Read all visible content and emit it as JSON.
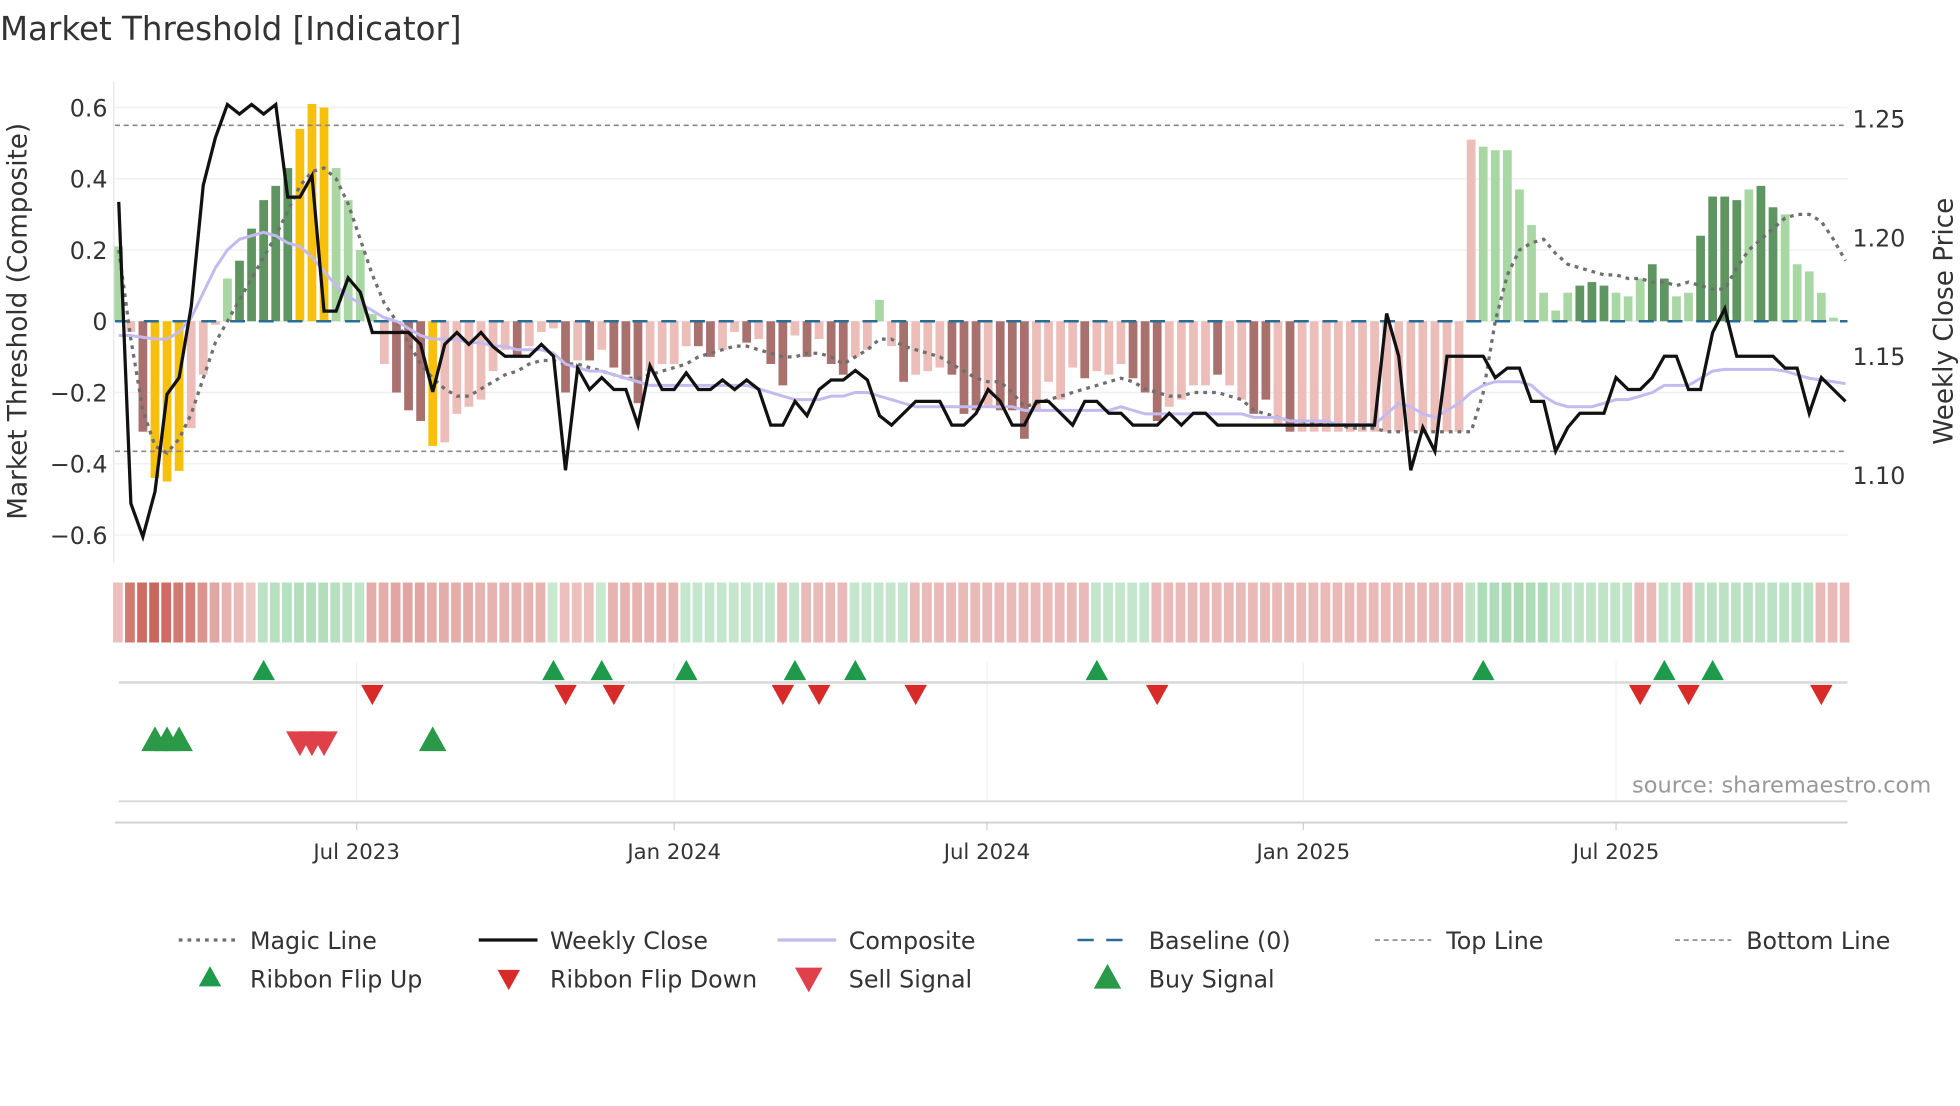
{
  "chart_data": {
    "type": "bar",
    "title": "Market Threshold [Indicator]",
    "ylabel": "Market Threshold (Composite)",
    "ylabel_right": "Weekly Close Price",
    "ylim": [
      -0.677,
      0.674
    ],
    "ylim_right": [
      1.0537,
      1.2605
    ],
    "y_ticks": [
      {
        "v": 0.6,
        "label": "0.6"
      },
      {
        "v": 0.4,
        "label": "0.4"
      },
      {
        "v": 0.2,
        "label": "0.2"
      },
      {
        "v": 0,
        "label": "0"
      },
      {
        "v": -0.2,
        "label": "−0.2"
      },
      {
        "v": -0.4,
        "label": "−0.4"
      },
      {
        "v": -0.6,
        "label": "−0.6"
      }
    ],
    "y_ticks_right": [
      {
        "v": 1.25,
        "label": "1.25"
      },
      {
        "v": 1.2,
        "label": "1.20"
      },
      {
        "v": 1.15,
        "label": "1.15"
      },
      {
        "v": 1.1,
        "label": "1.10"
      }
    ],
    "x_ticks": [
      {
        "week": 19.7,
        "label": "Jul 2023"
      },
      {
        "week": 46.0,
        "label": "Jan 2024"
      },
      {
        "week": 71.9,
        "label": "Jul 2024"
      },
      {
        "week": 98.1,
        "label": "Jan 2025"
      },
      {
        "week": 124.0,
        "label": "Jul 2025"
      }
    ],
    "top_line": 0.55,
    "bottom_line": -0.365,
    "grid": true,
    "source": "source: sharemaestro.com",
    "colors": {
      "L": "#a9d7a3",
      "G": "#5f9560",
      "P": "#ecbdb9",
      "R": "#a9716e",
      "Y": "#f7c00b",
      "close": "#111111",
      "composite": "#c5baef",
      "magic": "#6f6f6f",
      "baseline": "#2a6e96",
      "refline": "#888888"
    },
    "composite_bars": [
      0.21,
      -0.03,
      -0.31,
      -0.44,
      -0.45,
      -0.42,
      -0.3,
      -0.15,
      -0.01,
      0.12,
      0.17,
      0.26,
      0.34,
      0.38,
      0.43,
      0.54,
      0.61,
      0.6,
      0.43,
      0.34,
      0.2,
      0.02,
      -0.12,
      -0.2,
      -0.25,
      -0.28,
      -0.35,
      -0.34,
      -0.26,
      -0.24,
      -0.22,
      -0.14,
      -0.08,
      -0.1,
      -0.07,
      -0.03,
      -0.02,
      -0.2,
      -0.11,
      -0.11,
      -0.08,
      -0.13,
      -0.15,
      -0.23,
      -0.14,
      -0.12,
      -0.12,
      -0.07,
      -0.07,
      -0.1,
      -0.08,
      -0.03,
      -0.06,
      -0.05,
      -0.12,
      -0.18,
      -0.04,
      -0.1,
      -0.05,
      -0.12,
      -0.15,
      -0.1,
      -0.08,
      0.06,
      -0.07,
      -0.17,
      -0.15,
      -0.14,
      -0.13,
      -0.15,
      -0.26,
      -0.25,
      -0.24,
      -0.25,
      -0.25,
      -0.33,
      -0.25,
      -0.17,
      -0.22,
      -0.13,
      -0.16,
      -0.14,
      -0.15,
      -0.12,
      -0.16,
      -0.2,
      -0.28,
      -0.24,
      -0.22,
      -0.18,
      -0.18,
      -0.15,
      -0.18,
      -0.22,
      -0.26,
      -0.22,
      -0.29,
      -0.31,
      -0.31,
      -0.31,
      -0.31,
      -0.31,
      -0.31,
      -0.31,
      -0.31,
      -0.31,
      -0.31,
      -0.31,
      -0.31,
      -0.31,
      -0.31,
      -0.31,
      0.51,
      0.49,
      0.48,
      0.48,
      0.37,
      0.27,
      0.08,
      0.03,
      0.08,
      0.1,
      0.11,
      0.1,
      0.08,
      0.07,
      0.12,
      0.16,
      0.12,
      0.07,
      0.08,
      0.24,
      0.35,
      0.35,
      0.34,
      0.37,
      0.38,
      0.32,
      0.3,
      0.16,
      0.14,
      0.08,
      0.01
    ],
    "bar_states": "LPRYYYPPPLGGGGGYYYLLLLPRRRYPPPPPPRPPPRPRPRRRPPPPRRPPRPRRPRPRRPPLPRPPPRRRPRRRPPPPRPPPRRRPPPPRPPRRPRPPPPPPPPPPPPPPPLLLLLLLLGGGLLLGGLLGGGGLGGLLLLLL",
    "weekly_close": [
      1.215,
      1.088,
      1.074,
      1.093,
      1.134,
      1.141,
      1.171,
      1.222,
      1.242,
      1.256,
      1.252,
      1.256,
      1.252,
      1.256,
      1.217,
      1.217,
      1.226,
      1.169,
      1.169,
      1.183,
      1.177,
      1.16,
      1.16,
      1.16,
      1.16,
      1.155,
      1.135,
      1.155,
      1.16,
      1.155,
      1.16,
      1.154,
      1.15,
      1.15,
      1.15,
      1.155,
      1.15,
      1.102,
      1.145,
      1.136,
      1.141,
      1.136,
      1.136,
      1.121,
      1.146,
      1.136,
      1.136,
      1.143,
      1.136,
      1.136,
      1.14,
      1.136,
      1.14,
      1.136,
      1.121,
      1.121,
      1.131,
      1.125,
      1.136,
      1.14,
      1.14,
      1.144,
      1.14,
      1.125,
      1.121,
      1.126,
      1.131,
      1.131,
      1.131,
      1.121,
      1.121,
      1.126,
      1.136,
      1.131,
      1.121,
      1.121,
      1.131,
      1.131,
      1.126,
      1.121,
      1.131,
      1.131,
      1.126,
      1.126,
      1.121,
      1.121,
      1.121,
      1.126,
      1.121,
      1.126,
      1.126,
      1.121,
      1.121,
      1.121,
      1.121,
      1.121,
      1.121,
      1.121,
      1.121,
      1.121,
      1.121,
      1.121,
      1.121,
      1.121,
      1.121,
      1.168,
      1.15,
      1.102,
      1.12,
      1.11,
      1.15,
      1.15,
      1.15,
      1.15,
      1.141,
      1.145,
      1.145,
      1.131,
      1.131,
      1.11,
      1.12,
      1.126,
      1.126,
      1.126,
      1.141,
      1.136,
      1.136,
      1.141,
      1.15,
      1.15,
      1.136,
      1.136,
      1.16,
      1.17,
      1.15,
      1.15,
      1.15,
      1.15,
      1.145,
      1.145,
      1.126,
      1.141,
      1.136,
      1.131
    ],
    "magic_line": [
      0.2,
      -0.05,
      -0.25,
      -0.35,
      -0.37,
      -0.33,
      -0.26,
      -0.16,
      -0.06,
      0.0,
      0.06,
      0.12,
      0.18,
      0.24,
      0.31,
      0.38,
      0.42,
      0.43,
      0.4,
      0.33,
      0.23,
      0.13,
      0.05,
      0.0,
      -0.06,
      -0.12,
      -0.16,
      -0.19,
      -0.21,
      -0.21,
      -0.19,
      -0.17,
      -0.15,
      -0.14,
      -0.12,
      -0.11,
      -0.11,
      -0.12,
      -0.12,
      -0.13,
      -0.14,
      -0.15,
      -0.16,
      -0.16,
      -0.15,
      -0.14,
      -0.13,
      -0.12,
      -0.1,
      -0.09,
      -0.08,
      -0.07,
      -0.07,
      -0.08,
      -0.09,
      -0.1,
      -0.1,
      -0.09,
      -0.09,
      -0.1,
      -0.12,
      -0.1,
      -0.08,
      -0.05,
      -0.05,
      -0.07,
      -0.08,
      -0.09,
      -0.1,
      -0.12,
      -0.14,
      -0.16,
      -0.17,
      -0.17,
      -0.2,
      -0.24,
      -0.23,
      -0.22,
      -0.21,
      -0.2,
      -0.19,
      -0.18,
      -0.17,
      -0.16,
      -0.17,
      -0.19,
      -0.2,
      -0.21,
      -0.21,
      -0.2,
      -0.2,
      -0.2,
      -0.21,
      -0.22,
      -0.25,
      -0.26,
      -0.27,
      -0.28,
      -0.28,
      -0.29,
      -0.29,
      -0.29,
      -0.3,
      -0.3,
      -0.3,
      -0.31,
      -0.31,
      -0.31,
      -0.31,
      -0.31,
      -0.31,
      -0.31,
      -0.31,
      -0.2,
      0.0,
      0.13,
      0.2,
      0.22,
      0.23,
      0.19,
      0.16,
      0.15,
      0.14,
      0.13,
      0.13,
      0.12,
      0.12,
      0.11,
      0.11,
      0.1,
      0.11,
      0.1,
      0.09,
      0.09,
      0.15,
      0.2,
      0.23,
      0.26,
      0.29,
      0.3,
      0.3,
      0.28,
      0.23,
      0.17
    ],
    "composite_line": [
      -0.04,
      -0.04,
      -0.045,
      -0.05,
      -0.05,
      -0.03,
      0.01,
      0.08,
      0.15,
      0.2,
      0.23,
      0.24,
      0.25,
      0.24,
      0.22,
      0.21,
      0.18,
      0.14,
      0.1,
      0.07,
      0.05,
      0.03,
      0.01,
      0.0,
      -0.02,
      -0.04,
      -0.05,
      -0.05,
      -0.05,
      -0.06,
      -0.06,
      -0.07,
      -0.07,
      -0.08,
      -0.08,
      -0.08,
      -0.09,
      -0.12,
      -0.13,
      -0.14,
      -0.14,
      -0.15,
      -0.16,
      -0.17,
      -0.18,
      -0.18,
      -0.18,
      -0.18,
      -0.18,
      -0.18,
      -0.18,
      -0.18,
      -0.18,
      -0.19,
      -0.2,
      -0.21,
      -0.22,
      -0.22,
      -0.22,
      -0.21,
      -0.21,
      -0.2,
      -0.2,
      -0.21,
      -0.22,
      -0.23,
      -0.24,
      -0.24,
      -0.24,
      -0.24,
      -0.24,
      -0.24,
      -0.24,
      -0.24,
      -0.24,
      -0.25,
      -0.25,
      -0.25,
      -0.25,
      -0.25,
      -0.25,
      -0.25,
      -0.25,
      -0.24,
      -0.25,
      -0.26,
      -0.26,
      -0.26,
      -0.26,
      -0.26,
      -0.26,
      -0.26,
      -0.26,
      -0.26,
      -0.27,
      -0.27,
      -0.27,
      -0.28,
      -0.28,
      -0.28,
      -0.28,
      -0.29,
      -0.29,
      -0.29,
      -0.29,
      -0.26,
      -0.23,
      -0.24,
      -0.26,
      -0.27,
      -0.25,
      -0.23,
      -0.2,
      -0.18,
      -0.17,
      -0.17,
      -0.17,
      -0.18,
      -0.21,
      -0.23,
      -0.24,
      -0.24,
      -0.24,
      -0.23,
      -0.22,
      -0.22,
      -0.21,
      -0.2,
      -0.18,
      -0.18,
      -0.18,
      -0.16,
      -0.14,
      -0.135,
      -0.135,
      -0.135,
      -0.135,
      -0.135,
      -0.14,
      -0.15,
      -0.16,
      -0.165,
      -0.17,
      -0.175
    ],
    "ribbon": [
      -0.2,
      -0.75,
      -0.85,
      -0.9,
      -0.85,
      -0.75,
      -0.7,
      -0.55,
      -0.4,
      -0.3,
      -0.25,
      -0.15,
      0.35,
      0.4,
      0.4,
      0.45,
      0.45,
      0.45,
      0.4,
      0.35,
      0.3,
      -0.35,
      -0.35,
      -0.4,
      -0.4,
      -0.4,
      -0.35,
      -0.35,
      -0.35,
      -0.35,
      -0.3,
      -0.3,
      -0.3,
      -0.3,
      -0.3,
      -0.3,
      0.2,
      -0.2,
      -0.2,
      -0.2,
      0.2,
      -0.3,
      -0.3,
      -0.3,
      -0.3,
      -0.3,
      -0.3,
      0.25,
      0.25,
      0.25,
      0.25,
      0.25,
      0.25,
      0.25,
      0.25,
      -0.25,
      0.25,
      -0.25,
      -0.25,
      -0.25,
      -0.25,
      0.25,
      0.25,
      0.25,
      0.25,
      0.25,
      -0.25,
      -0.25,
      -0.25,
      -0.25,
      -0.25,
      -0.25,
      -0.25,
      -0.25,
      -0.25,
      -0.25,
      -0.25,
      -0.25,
      -0.25,
      -0.25,
      -0.25,
      0.25,
      0.25,
      0.25,
      0.25,
      0.25,
      -0.25,
      -0.25,
      -0.25,
      -0.25,
      -0.25,
      -0.25,
      -0.25,
      -0.25,
      -0.25,
      -0.25,
      -0.25,
      -0.25,
      -0.25,
      -0.25,
      -0.25,
      -0.25,
      -0.25,
      -0.25,
      -0.25,
      -0.25,
      -0.25,
      -0.25,
      -0.25,
      -0.25,
      -0.25,
      -0.25,
      0.3,
      0.5,
      0.5,
      0.55,
      0.55,
      0.5,
      0.5,
      0.3,
      0.3,
      0.3,
      0.3,
      0.3,
      0.3,
      0.3,
      -0.25,
      -0.25,
      0.3,
      0.3,
      -0.25,
      0.35,
      0.35,
      0.35,
      0.35,
      0.35,
      0.35,
      0.35,
      0.35,
      0.35,
      0.35,
      -0.25,
      -0.25,
      -0.25
    ],
    "ribbon_flip_up": [
      12,
      36,
      40,
      47,
      56,
      61,
      81,
      113,
      128,
      132
    ],
    "ribbon_flip_down": [
      21,
      37,
      41,
      55,
      58,
      66,
      86,
      126,
      130,
      141
    ],
    "buy_signals": [
      3,
      4,
      5,
      26
    ],
    "sell_signals": [
      15,
      16,
      17
    ],
    "legend": [
      {
        "label": "Magic Line",
        "symbol": "dotted"
      },
      {
        "label": "Weekly Close",
        "symbol": "line"
      },
      {
        "label": "Composite",
        "symbol": "lavender"
      },
      {
        "label": "Baseline (0)",
        "symbol": "dashed-blue"
      },
      {
        "label": "Top Line",
        "symbol": "dashed-gray"
      },
      {
        "label": "Bottom Line",
        "symbol": "dashed-gray"
      },
      {
        "label": "Ribbon Flip Up",
        "symbol": "tri-up-small"
      },
      {
        "label": "Ribbon Flip Down",
        "symbol": "tri-down-small"
      },
      {
        "label": "Sell Signal",
        "symbol": "tri-down"
      },
      {
        "label": "Buy Signal",
        "symbol": "tri-up"
      }
    ]
  }
}
